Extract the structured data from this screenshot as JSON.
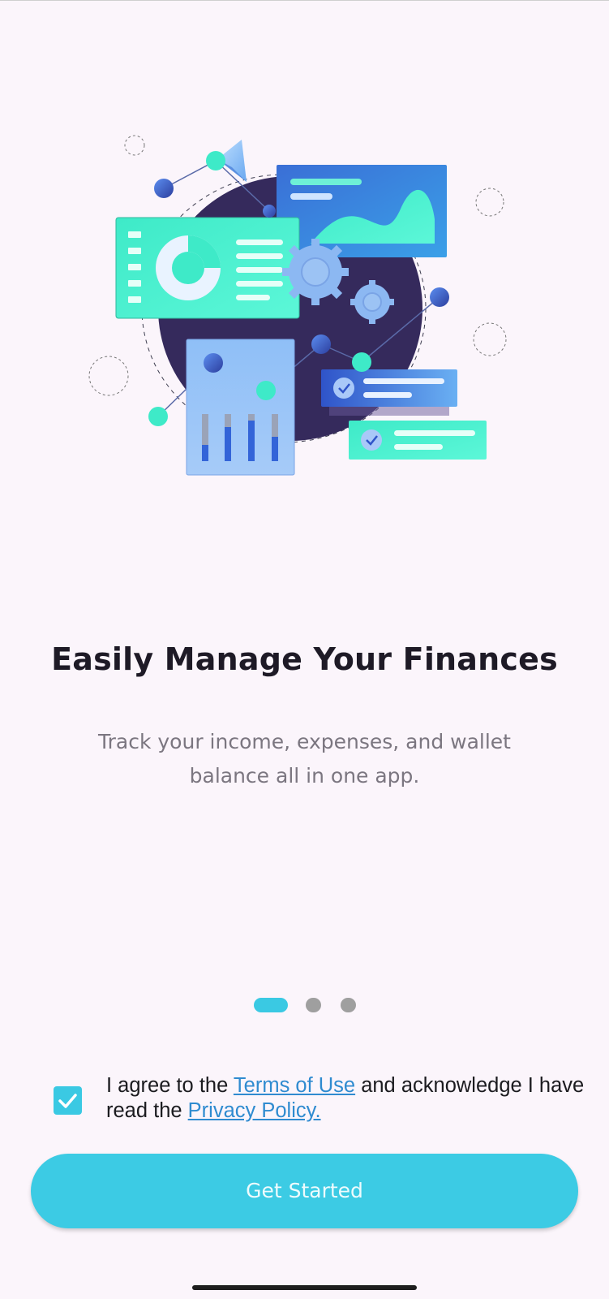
{
  "onboarding": {
    "illustration_name": "finance-dashboard-illustration",
    "title": "Easily Manage Your Finances",
    "subtitle": "Track your income, expenses, and wallet balance all in one app."
  },
  "pager": {
    "total": 3,
    "active_index": 0
  },
  "agreement": {
    "checked": true,
    "text_before": "I agree to the ",
    "terms_link": "Terms of Use",
    "text_middle": " and acknowledge I have read the ",
    "privacy_link": "Privacy Policy."
  },
  "cta": {
    "label": "Get Started"
  },
  "colors": {
    "background": "#fbf5fb",
    "accent": "#3ac9e3",
    "link": "#2f8bd0",
    "title": "#1e1a26",
    "subtitle": "#7b7680"
  },
  "icons": {
    "checkbox": "checkmark-icon"
  }
}
